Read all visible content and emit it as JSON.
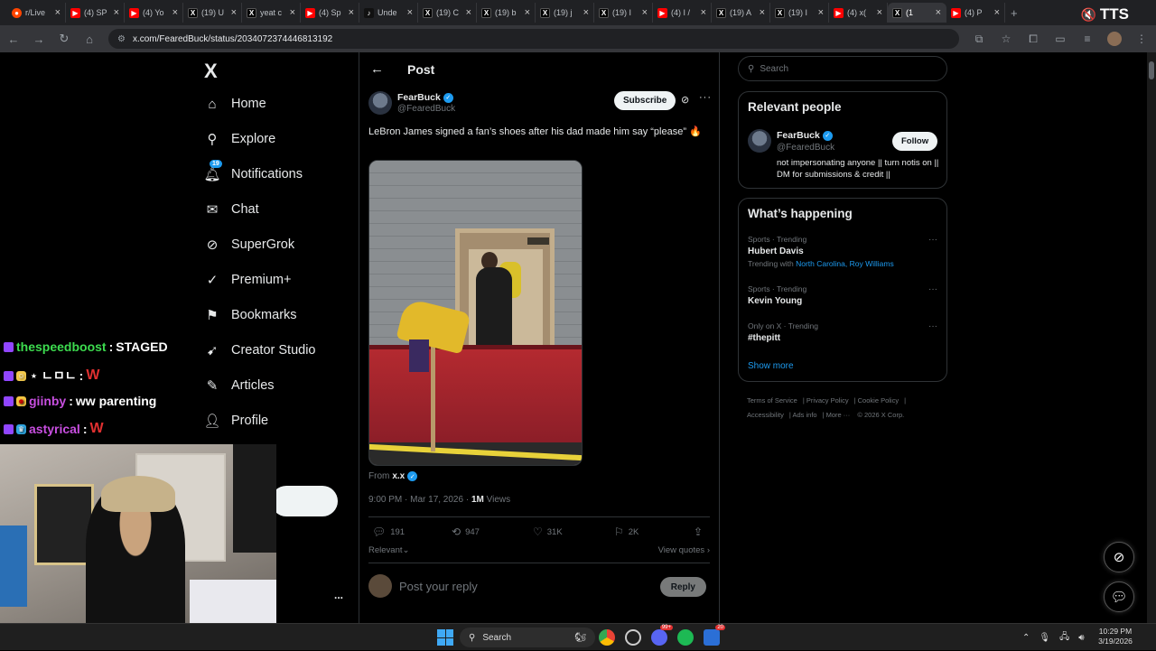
{
  "browser": {
    "tabs": [
      {
        "icon": "reddit-icon",
        "title": "r/Live"
      },
      {
        "icon": "youtube-icon",
        "title": "(4) SP"
      },
      {
        "icon": "youtube-icon",
        "title": "(4) Yo"
      },
      {
        "icon": "x-icon",
        "title": "(19) U"
      },
      {
        "icon": "x-icon",
        "title": "yeat c"
      },
      {
        "icon": "youtube-icon",
        "title": "(4) Sp"
      },
      {
        "icon": "tiktok-icon",
        "title": "Unde"
      },
      {
        "icon": "x-icon",
        "title": "(19) C"
      },
      {
        "icon": "x-icon",
        "title": "(19) b"
      },
      {
        "icon": "x-icon",
        "title": "(19) j"
      },
      {
        "icon": "x-icon",
        "title": "(19) I"
      },
      {
        "icon": "youtube-icon",
        "title": "(4) I /"
      },
      {
        "icon": "x-icon",
        "title": "(19) A"
      },
      {
        "icon": "x-icon",
        "title": "(19) I"
      },
      {
        "icon": "youtube-icon",
        "title": "(4) x("
      },
      {
        "icon": "x-icon",
        "title": "(1",
        "active": true
      },
      {
        "icon": "youtube-icon",
        "title": "(4) P"
      }
    ],
    "tts_label": "TTS",
    "url": "x.com/FearedBuck/status/2034072374446813192"
  },
  "left_nav": {
    "logo": "X",
    "items": [
      {
        "label": "Home",
        "icon": "home-icon"
      },
      {
        "label": "Explore",
        "icon": "search-icon"
      },
      {
        "label": "Notifications",
        "icon": "bell-icon",
        "badge": "19"
      },
      {
        "label": "Chat",
        "icon": "mail-icon"
      },
      {
        "label": "SuperGrok",
        "icon": "grok-icon"
      },
      {
        "label": "Premium+",
        "icon": "verified-icon"
      },
      {
        "label": "Bookmarks",
        "icon": "bookmark-icon"
      },
      {
        "label": "Creator Studio",
        "icon": "rocket-icon"
      },
      {
        "label": "Articles",
        "icon": "article-icon"
      },
      {
        "label": "Profile",
        "icon": "person-icon"
      }
    ],
    "more_label": "..."
  },
  "stream_chat": [
    {
      "user": "thespeedboost",
      "user_color": "#3ddc4f",
      "message": "STAGED"
    },
    {
      "user": "ㄴㅁㄴ",
      "user_color": "#ffffff",
      "message": "W",
      "message_color": "#e03030"
    },
    {
      "user": "giinby",
      "user_color": "#c84fe0",
      "message": "ww parenting"
    },
    {
      "user": "astyrical",
      "user_color": "#c84fe0",
      "message": "W",
      "message_color": "#e03030"
    }
  ],
  "post": {
    "header_title": "Post",
    "author_name": "FearBuck",
    "author_handle": "@FearedBuck",
    "subscribe_label": "Subscribe",
    "text": "LeBron James signed a fan’s shoes after his dad made him say “please” 🔥",
    "from_label": "From",
    "from_user": "x.x",
    "timestamp": "9:00 PM · Mar 17, 2026 · ",
    "views_count": "1M",
    "views_label": " Views",
    "replies": "191",
    "reposts": "947",
    "likes": "31K",
    "bookmarks": "2K",
    "sort_label": "Relevant",
    "view_quotes_label": "View quotes",
    "reply_placeholder": "Post your reply",
    "reply_button": "Reply"
  },
  "right_col": {
    "search_placeholder": "Search",
    "relevant_people": {
      "title": "Relevant people",
      "name": "FearBuck",
      "handle": "@FearedBuck",
      "follow_label": "Follow",
      "bio": "not impersonating anyone || turn notis on || DM for submissions & credit ||"
    },
    "whats_happening": {
      "title": "What’s happening",
      "trends": [
        {
          "context": "Sports · Trending",
          "name": "Hubert Davis",
          "with_label": "Trending with ",
          "with_links": "North Carolina, Roy Williams"
        },
        {
          "context": "Sports · Trending",
          "name": "Kevin Young"
        },
        {
          "context": "Only on X · Trending",
          "name": "#thepitt"
        }
      ],
      "show_more": "Show more"
    },
    "footer_links": [
      "Terms of Service",
      "Privacy Policy",
      "Cookie Policy",
      "Accessibility",
      "Ads info",
      "More ···",
      "© 2026 X Corp."
    ]
  },
  "taskbar": {
    "search_label": "Search",
    "time": "10:29 PM",
    "date": "3/19/2026",
    "discord_badge": "99+",
    "app_badge": "20"
  },
  "colors": {
    "accent": "#1d9bf0",
    "background": "#000000",
    "border": "#2f3336",
    "muted": "#71767b"
  }
}
